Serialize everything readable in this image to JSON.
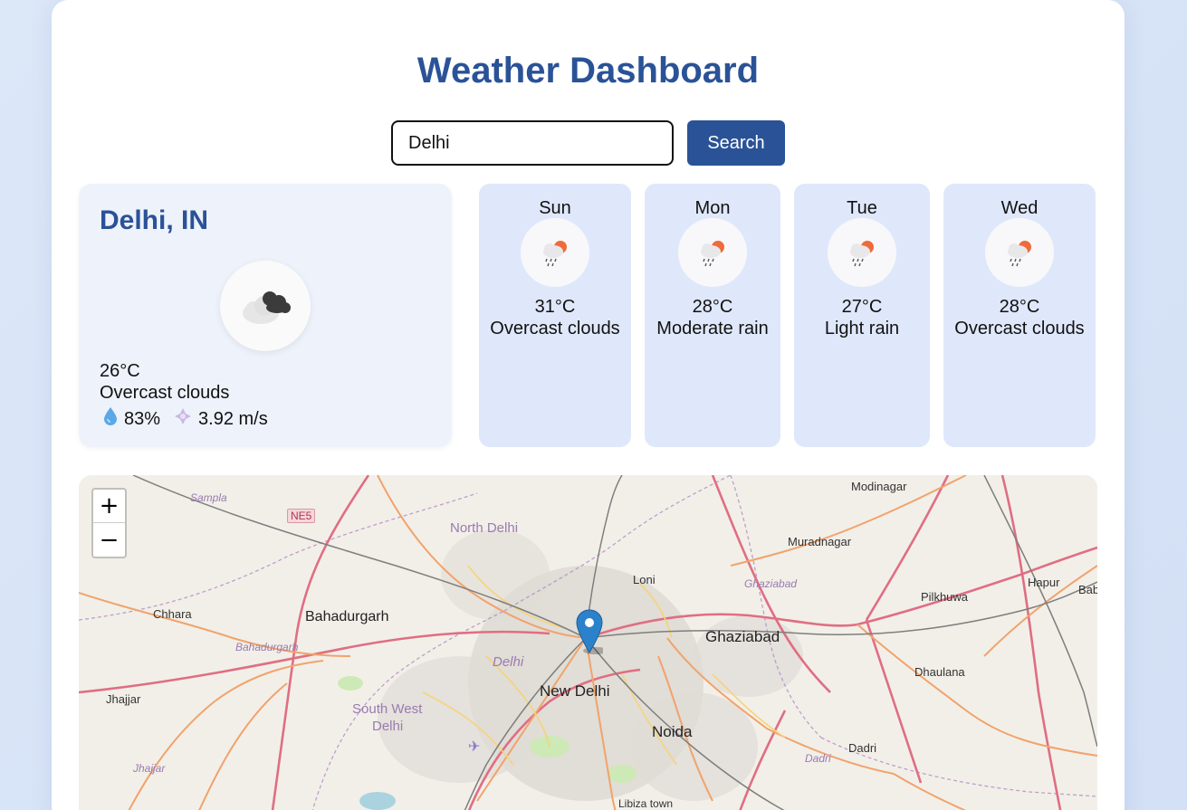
{
  "app": {
    "title": "Weather Dashboard"
  },
  "search": {
    "value": "Delhi",
    "button_label": "Search"
  },
  "current": {
    "city": "Delhi, IN",
    "icon": "overcast-cloud-icon",
    "temp": "26°C",
    "description": "Overcast clouds",
    "humidity": "83%",
    "wind": "3.92 m/s",
    "humidity_icon": "droplet-icon",
    "wind_icon": "wind-icon"
  },
  "forecast": [
    {
      "day": "Sun",
      "temp": "31°C",
      "description": "Overcast clouds",
      "icon": "rain-sun-icon"
    },
    {
      "day": "Mon",
      "temp": "28°C",
      "description": "Moderate rain",
      "icon": "rain-sun-icon"
    },
    {
      "day": "Tue",
      "temp": "27°C",
      "description": "Light rain",
      "icon": "rain-sun-icon"
    },
    {
      "day": "Wed",
      "temp": "28°C",
      "description": "Overcast clouds",
      "icon": "rain-sun-icon"
    }
  ],
  "map": {
    "zoom_in": "+",
    "zoom_out": "−",
    "marker": "map-pin-icon",
    "labels": {
      "sampla": "Sampla",
      "ne5": "NE5",
      "north_delhi": "North Delhi",
      "modinagar": "Modinagar",
      "muradnagar": "Muradnagar",
      "loni": "Loni",
      "ghaziabad_district": "Ghaziabad",
      "hapur": "Hapur",
      "bab": "Bab",
      "pilkhuwa": "Pilkhuwa",
      "chhara": "Chhara",
      "bahadurgarh": "Bahadurgarh",
      "bahadurgarh_district": "Bahadurgarh",
      "delhi": "Delhi",
      "ghaziabad": "Ghaziabad",
      "dhaulana": "Dhaulana",
      "jhajjar": "Jhajjar",
      "new_delhi": "New Delhi",
      "south_west_delhi": "South West",
      "south_west_delhi_2": "Delhi",
      "noida": "Noida",
      "dadri": "Dadri",
      "dadri_district": "Dadri",
      "jhajjar_district": "Jhajjar",
      "libiza_town": "Libiza town"
    }
  },
  "colors": {
    "accent": "#2a5297",
    "card_bg": "#eef2fb",
    "forecast_bg": "#dfe8fb",
    "page_bg": "#dce7f8"
  }
}
